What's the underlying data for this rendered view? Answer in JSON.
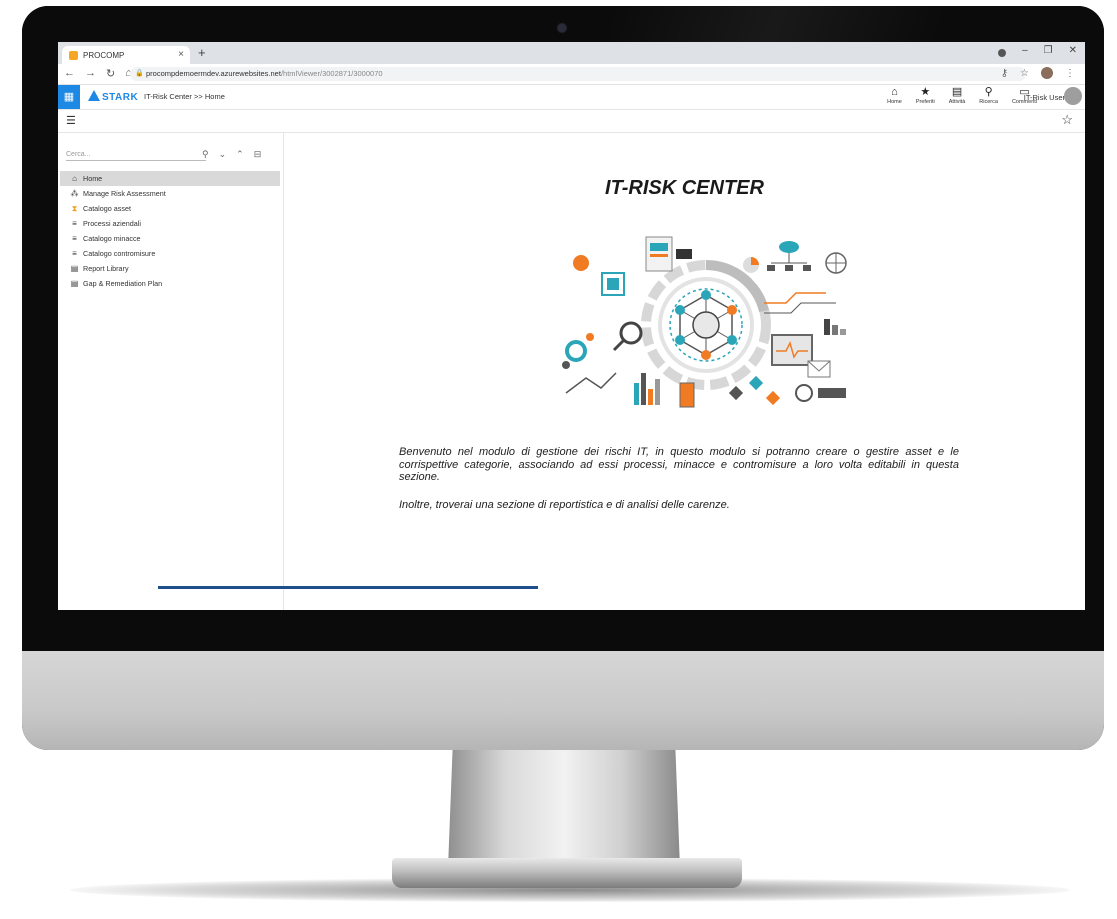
{
  "browser": {
    "tab_title": "PROCOMP",
    "tab_close": "×",
    "new_tab": "+",
    "url_main": "procompdemoermdev.azurewebsites.net",
    "url_path": "/htmlViewer/3002871/3000070"
  },
  "app": {
    "logo": "STARK",
    "breadcrumb": "IT-Risk Center >> Home",
    "tools": [
      {
        "label": "Home",
        "icon": "home-icon"
      },
      {
        "label": "Preferiti",
        "icon": "star-icon"
      },
      {
        "label": "Attività",
        "icon": "clipboard-icon"
      },
      {
        "label": "Ricerca",
        "icon": "search-icon"
      },
      {
        "label": "Commenti",
        "icon": "comment-icon"
      }
    ],
    "user": "IT-Risk User"
  },
  "sidebar": {
    "search_placeholder": "Cerca...",
    "items": [
      {
        "label": "Home",
        "icon": "home-icon"
      },
      {
        "label": "Manage Risk Assessment",
        "icon": "network-icon"
      },
      {
        "label": "Catalogo asset",
        "icon": "hourglass-icon"
      },
      {
        "label": "Processi aziendali",
        "icon": "list-icon"
      },
      {
        "label": "Catalogo minacce",
        "icon": "list-icon"
      },
      {
        "label": "Catalogo contromisure",
        "icon": "list-icon"
      },
      {
        "label": "Report Library",
        "icon": "document-icon"
      },
      {
        "label": "Gap & Remediation Plan",
        "icon": "document-icon"
      }
    ]
  },
  "main": {
    "title": "IT-RISK CENTER",
    "paragraph1": "Benvenuto nel modulo di gestione dei rischi IT, in questo modulo si potranno creare o gestire asset e le corrispettive categorie, associando ad essi processi, minacce e contromisure a loro volta editabili in questa sezione.",
    "paragraph2": "Inoltre, troverai una sezione di reportistica e di analisi delle carenze."
  },
  "colors": {
    "accent": "#1e88e5",
    "bluebar": "#1f4e8c",
    "illustration_orange": "#f07b22",
    "illustration_teal": "#2aa6b8"
  }
}
